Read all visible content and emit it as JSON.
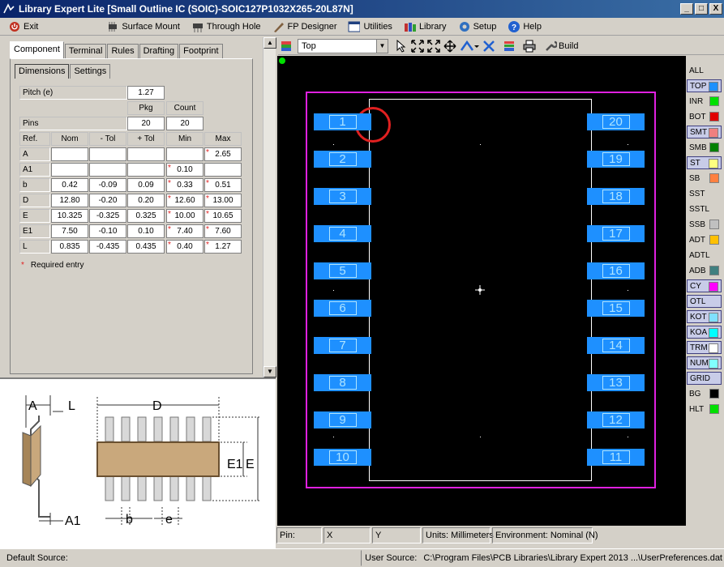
{
  "window": {
    "title": "Library Expert Lite [Small Outline IC (SOIC)-SOIC127P1032X265-20L87N]",
    "min": "_",
    "max": "□",
    "close": "X"
  },
  "menu": [
    {
      "label": "Exit",
      "icon": "exit-icon"
    },
    {
      "label": "Surface Mount",
      "icon": "surface-mount-icon"
    },
    {
      "label": "Through Hole",
      "icon": "through-hole-icon"
    },
    {
      "label": "FP Designer",
      "icon": "fp-designer-icon"
    },
    {
      "label": "Utilities",
      "icon": "utilities-icon"
    },
    {
      "label": "Library",
      "icon": "library-icon"
    },
    {
      "label": "Setup",
      "icon": "setup-icon"
    },
    {
      "label": "Help",
      "icon": "help-icon"
    }
  ],
  "tabs": [
    "Component",
    "Terminal",
    "Rules",
    "Drafting",
    "Footprint"
  ],
  "subtabs": [
    "Dimensions",
    "Settings"
  ],
  "dims": {
    "pitch_label": "Pitch (e)",
    "pitch_value": "1.27",
    "pkg_header": "Pkg",
    "count_header": "Count",
    "pins_label": "Pins",
    "pins_pkg": "20",
    "pins_count": "20",
    "headers": [
      "Ref.",
      "Nom",
      "- Tol",
      "+ Tol",
      "Min",
      "Max"
    ],
    "rows": [
      {
        "ref": "A",
        "nom": "",
        "mtol": "",
        "ptol": "",
        "min": "",
        "min_req": false,
        "max": "2.65",
        "max_req": true
      },
      {
        "ref": "A1",
        "nom": "",
        "mtol": "",
        "ptol": "",
        "min": "0.10",
        "min_req": true,
        "max": "",
        "max_req": false
      },
      {
        "ref": "b",
        "nom": "0.42",
        "mtol": "-0.09",
        "ptol": "0.09",
        "min": "0.33",
        "min_req": true,
        "max": "0.51",
        "max_req": true
      },
      {
        "ref": "D",
        "nom": "12.80",
        "mtol": "-0.20",
        "ptol": "0.20",
        "min": "12.60",
        "min_req": true,
        "max": "13.00",
        "max_req": true
      },
      {
        "ref": "E",
        "nom": "10.325",
        "mtol": "-0.325",
        "ptol": "0.325",
        "min": "10.00",
        "min_req": true,
        "max": "10.65",
        "max_req": true
      },
      {
        "ref": "E1",
        "nom": "7.50",
        "mtol": "-0.10",
        "ptol": "0.10",
        "min": "7.40",
        "min_req": true,
        "max": "7.60",
        "max_req": true
      },
      {
        "ref": "L",
        "nom": "0.835",
        "mtol": "-0.435",
        "ptol": "0.435",
        "min": "0.40",
        "min_req": true,
        "max": "1.27",
        "max_req": true
      }
    ],
    "required_note": "Required entry",
    "req_mark": "*"
  },
  "diagram_labels": {
    "A": "A",
    "L": "L",
    "D": "D",
    "E1": "E1",
    "E": "E",
    "A1": "A1",
    "b": "b",
    "e": "e"
  },
  "toolbar": {
    "layer_value": "Top",
    "build_label": "Build"
  },
  "layers": [
    {
      "name": "ALL",
      "color": "",
      "selected": false
    },
    {
      "name": "TOP",
      "color": "#1e90ff",
      "selected": true
    },
    {
      "name": "INR",
      "color": "#00e000",
      "selected": false
    },
    {
      "name": "BOT",
      "color": "#e00000",
      "selected": false
    },
    {
      "name": "SMT",
      "color": "#f08080",
      "selected": true
    },
    {
      "name": "SMB",
      "color": "#008000",
      "selected": false
    },
    {
      "name": "ST",
      "color": "#ffff80",
      "selected": true
    },
    {
      "name": "SB",
      "color": "#ff8040",
      "selected": false
    },
    {
      "name": "SST",
      "color": "",
      "selected": false
    },
    {
      "name": "SSTL",
      "color": "",
      "selected": false
    },
    {
      "name": "SSB",
      "color": "#c0c0c0",
      "selected": false
    },
    {
      "name": "ADT",
      "color": "#ffc000",
      "selected": false
    },
    {
      "name": "ADTL",
      "color": "",
      "selected": false
    },
    {
      "name": "ADB",
      "color": "#408080",
      "selected": false
    },
    {
      "name": "CY",
      "color": "#ff00ff",
      "selected": true
    },
    {
      "name": "OTL",
      "color": "",
      "selected": true
    },
    {
      "name": "KOT",
      "color": "#80e0ff",
      "selected": true
    },
    {
      "name": "KOA",
      "color": "#00ffff",
      "selected": true
    },
    {
      "name": "TRM",
      "color": "#ffffff",
      "selected": true
    },
    {
      "name": "NUM",
      "color": "#80ffff",
      "selected": true
    },
    {
      "name": "GRID",
      "color": "",
      "selected": true
    },
    {
      "name": "BG",
      "color": "#000000",
      "selected": false
    },
    {
      "name": "HLT",
      "color": "#00e000",
      "selected": false
    }
  ],
  "pads_left": [
    "1",
    "2",
    "3",
    "4",
    "5",
    "6",
    "7",
    "8",
    "9",
    "10"
  ],
  "pads_right": [
    "20",
    "19",
    "18",
    "17",
    "16",
    "15",
    "14",
    "13",
    "12",
    "11"
  ],
  "status": {
    "pin": "Pin:",
    "x": "X",
    "y": "Y",
    "units": "Units: Millimeters",
    "env": "Environment: Nominal (N)",
    "default_source": "Default Source:",
    "user_source": "User Source:",
    "user_source_path": "C:\\Program Files\\PCB Libraries\\Library Expert 2013 ...\\UserPreferences.dat"
  }
}
